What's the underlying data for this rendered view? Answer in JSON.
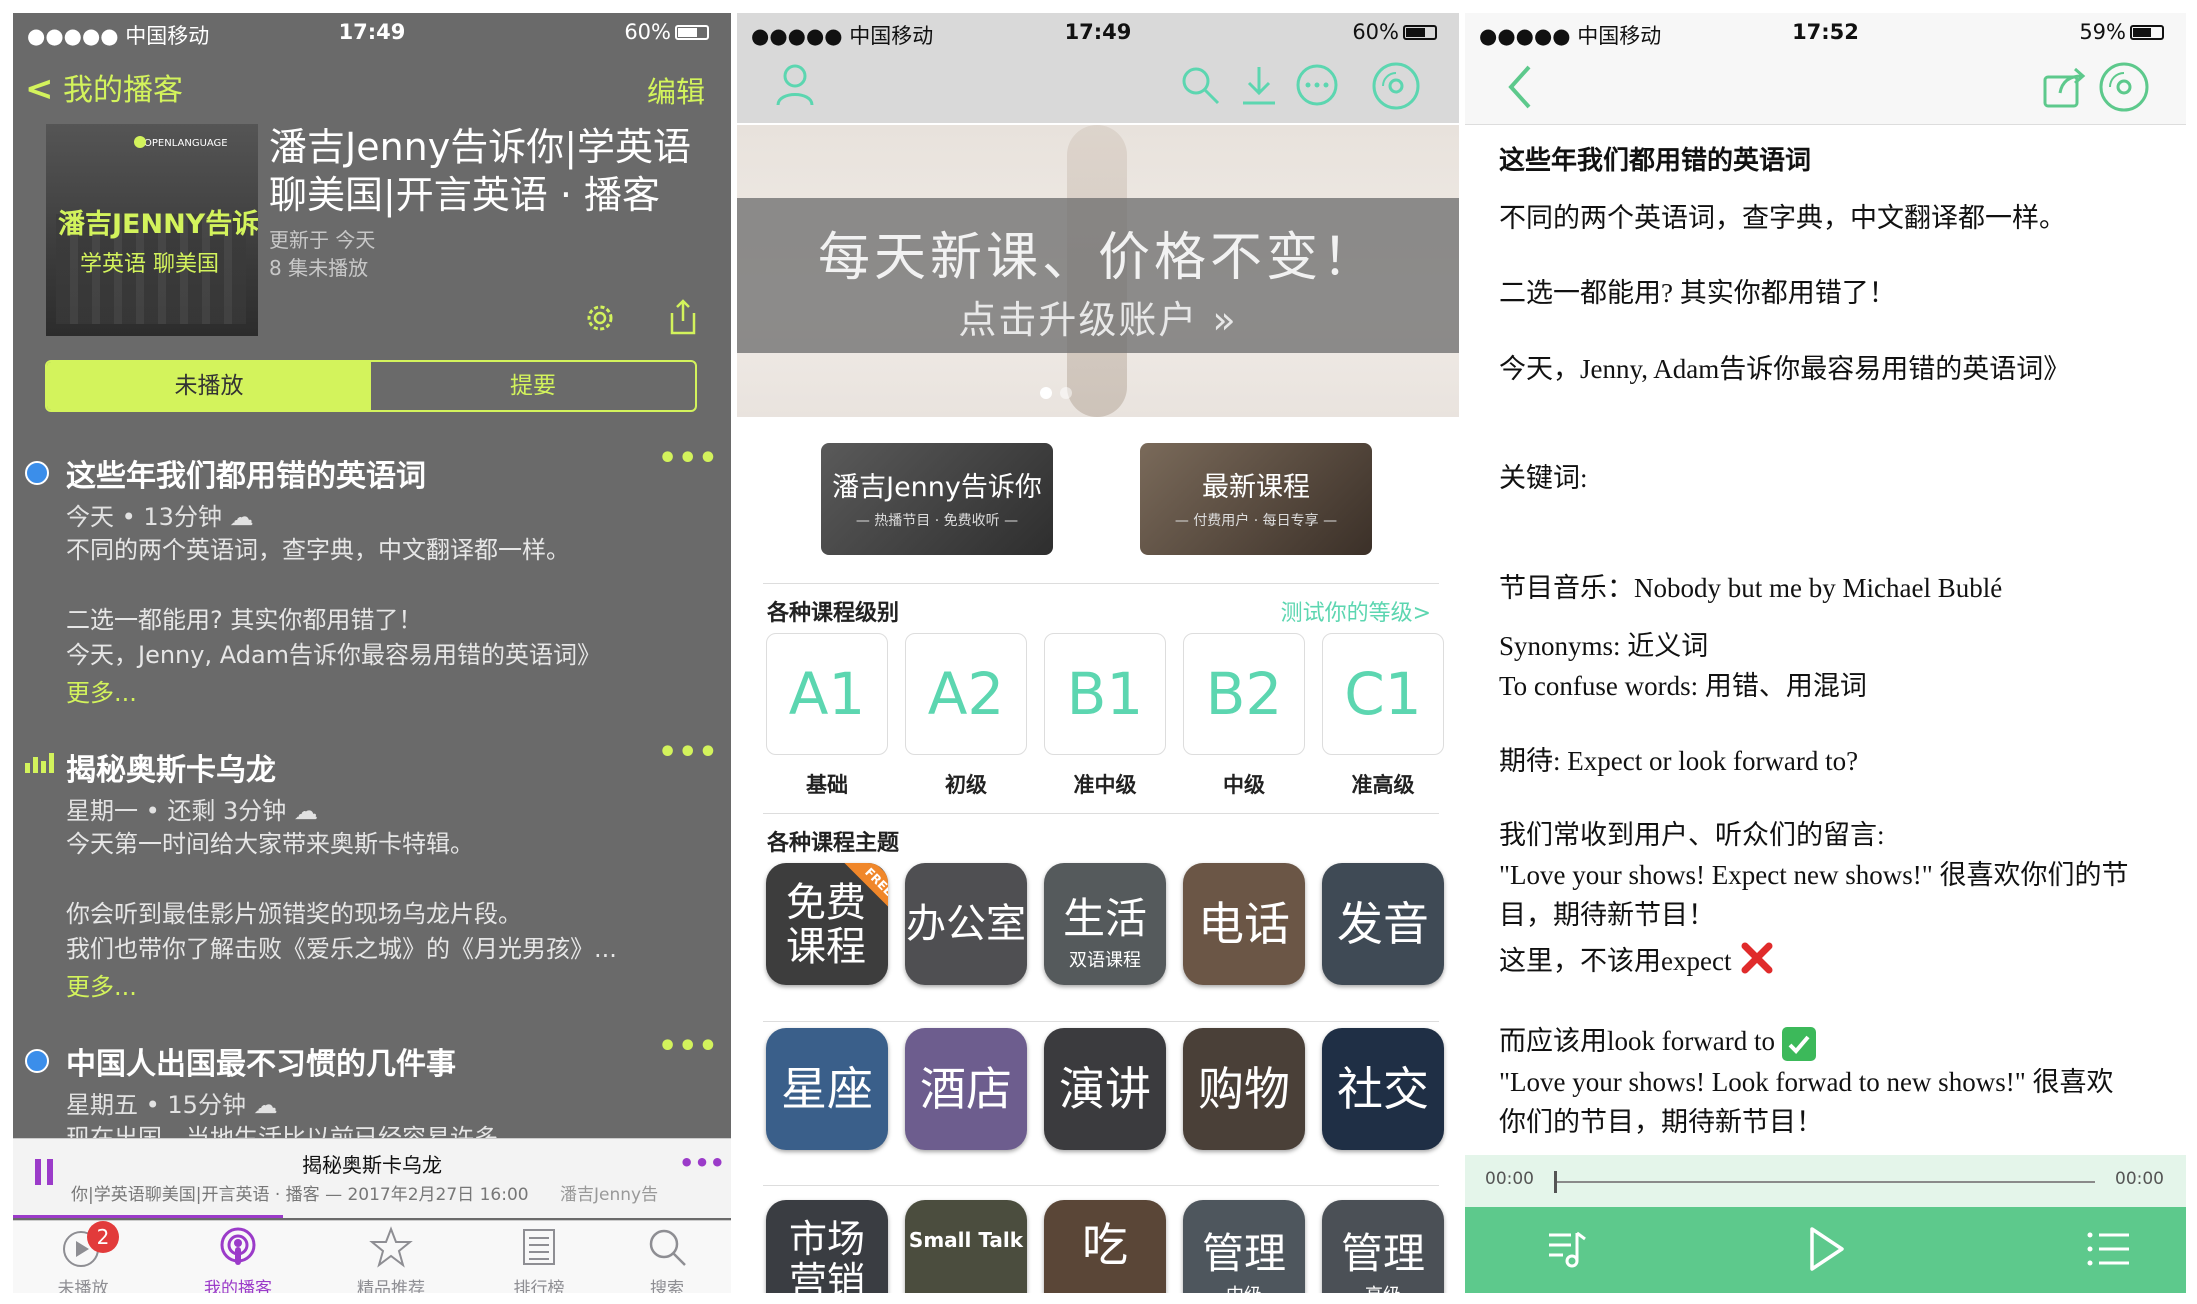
{
  "panel1": {
    "status": {
      "carrier": "●●●●● 中国移动",
      "time": "17:49",
      "battery": "60%"
    },
    "nav": {
      "back": "我的播客",
      "edit": "编辑"
    },
    "cover": {
      "brand": "OPENLANGUAGE",
      "line1": "潘吉JENNY告诉你",
      "line2": "学英语 聊美国"
    },
    "podcast": {
      "title": "潘吉Jenny告诉你|学英语聊美国|开言英语 · 播客",
      "updated": "更新于 今天",
      "unplayed": "8 集未播放"
    },
    "segments": [
      "未播放",
      "提要"
    ],
    "episodes": [
      {
        "title": "这些年我们都用错的英语词",
        "meta": "今天 • 13分钟 ☁",
        "desc1": "不同的两个英语词，查字典，中文翻译都一样。",
        "desc2": "二选一都能用? 其实你都用错了！",
        "desc3": "今天，Jenny, Adam告诉你最容易用错的英语词》",
        "more": "更多..."
      },
      {
        "title": "揭秘奥斯卡乌龙",
        "meta": "星期一 • 还剩 3分钟 ☁",
        "desc1": "今天第一时间给大家带来奥斯卡特辑。",
        "desc2": "你会听到最佳影片颁错奖的现场乌龙片段。",
        "desc3": "我们也带你了解击败《爱乐之城》的《月光男孩》...",
        "more": "更多..."
      },
      {
        "title": "中国人出国最不习惯的几件事",
        "meta": "星期五 • 15分钟 ☁",
        "desc1": "现在出国，当地生活比以前已经容易许多。"
      }
    ],
    "player": {
      "title": "揭秘奥斯卡乌龙",
      "sub": "你|学英语聊美国|开言英语 · 播客 — 2017年2月27日 16:00",
      "sub2": "潘吉Jenny告"
    },
    "tabs": [
      {
        "label": "未播放",
        "badge": "2"
      },
      {
        "label": "我的播客"
      },
      {
        "label": "精品推荐"
      },
      {
        "label": "排行榜"
      },
      {
        "label": "搜索"
      }
    ],
    "colors": {
      "accent": "#d3f35c",
      "active_tab": "#9b3bc9"
    }
  },
  "panel2": {
    "status": {
      "carrier": "●●●●● 中国移动",
      "time": "17:49",
      "battery": "60%"
    },
    "banner": {
      "headline": "每天新课、价格不变！",
      "cta": "点击升级账户 »"
    },
    "cards": [
      {
        "title": "潘吉Jenny告诉你",
        "sub": "— 热播节目 · 免费收听 —"
      },
      {
        "title": "最新课程",
        "sub": "— 付费用户 · 每日专享 —"
      }
    ],
    "levels_header": "各种课程级别",
    "levels_link": "测试你的等级>",
    "levels": [
      {
        "code": "A1",
        "name": "基础"
      },
      {
        "code": "A2",
        "name": "初级"
      },
      {
        "code": "B1",
        "name": "准中级"
      },
      {
        "code": "B2",
        "name": "中级"
      },
      {
        "code": "C1",
        "name": "准高级"
      }
    ],
    "topics_header": "各种课程主题",
    "topics_row1": [
      {
        "label": "免费课程",
        "sub": "",
        "ribbon": "FREE",
        "color": "#3d3d3d"
      },
      {
        "label": "办公室",
        "sub": "",
        "color": "#4f4f52"
      },
      {
        "label": "生活",
        "sub": "双语课程",
        "color": "#555a5c"
      },
      {
        "label": "电话",
        "sub": "",
        "color": "#6b5646"
      },
      {
        "label": "发音",
        "sub": "",
        "color": "#3f4a55"
      }
    ],
    "topics_row2": [
      {
        "label": "星座",
        "color": "#3a5f8a"
      },
      {
        "label": "酒店",
        "color": "#6d5d8e"
      },
      {
        "label": "演讲",
        "color": "#3b3b3e"
      },
      {
        "label": "购物",
        "color": "#4a4038"
      },
      {
        "label": "社交",
        "color": "#1f2f45"
      }
    ],
    "topics_row3": [
      {
        "label": "市场营销",
        "color": "#3a3d42"
      },
      {
        "label": "Small Talk",
        "color": "#4b4d3e"
      },
      {
        "label": "吃",
        "color": "#5a4637"
      },
      {
        "label": "管理",
        "sub": "中级",
        "color": "#4e565d"
      },
      {
        "label": "管理",
        "sub": "高级",
        "color": "#4b5056"
      }
    ],
    "colors": {
      "teal": "#5cd6b0",
      "banner_band": "#7a7a7a"
    }
  },
  "panel3": {
    "status": {
      "carrier": "●●●●● 中国移动",
      "time": "17:52",
      "battery": "59%"
    },
    "lines": [
      "这些年我们都用错的英语词",
      "不同的两个英语词，查字典，中文翻译都一样。",
      "二选一都能用? 其实你都用错了！",
      "今天，Jenny, Adam告诉你最容易用错的英语词》",
      "关键词:",
      "节目音乐：Nobody but me by Michael Bublé",
      "Synonyms: 近义词",
      "To confuse words: 用错、用混词",
      "期待: Expect or look forward to?",
      "我们常收到用户、听众们的留言:",
      "\"Love your shows! Expect new shows!\"  很喜欢你们的节",
      "目，期待新节目！",
      "这里，不该用expect",
      "而应该用look forward to",
      "\"Love your shows! Look forwad to new shows!\"  很喜欢",
      "你们的节目，期待新节目！"
    ],
    "player": {
      "elapsed": "00:00",
      "remaining": "00:00"
    },
    "colors": {
      "player_bg": "#5dc98c",
      "cross": "#e02b2b",
      "check": "#3cb95a"
    }
  }
}
